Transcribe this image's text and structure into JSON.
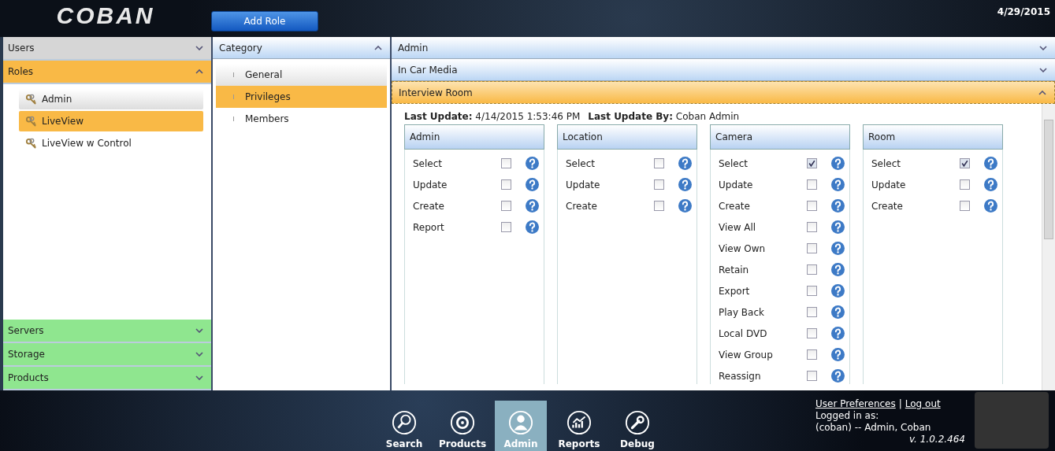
{
  "header": {
    "logo": "COBAN",
    "add_button": "Add Role",
    "date": "4/29/2015"
  },
  "sidebar": {
    "sections": [
      {
        "label": "Users",
        "expanded": false,
        "color": "#d6d6d6"
      },
      {
        "label": "Roles",
        "expanded": true,
        "color": "#f9b946",
        "items": [
          {
            "label": "Admin",
            "selected": false
          },
          {
            "label": "LiveView",
            "selected": true
          },
          {
            "label": "LiveView w Control",
            "selected": false
          }
        ]
      },
      {
        "label": "Servers",
        "expanded": false,
        "color": "#8fe68f"
      },
      {
        "label": "Storage",
        "expanded": false,
        "color": "#8fe68f"
      },
      {
        "label": "Products",
        "expanded": false,
        "color": "#8fe68f"
      }
    ]
  },
  "category": {
    "title": "Category",
    "expanded": true,
    "items": [
      {
        "label": "General",
        "selected": false
      },
      {
        "label": "Privileges",
        "selected": true
      },
      {
        "label": "Members",
        "selected": false
      }
    ]
  },
  "panels": [
    {
      "title": "Admin",
      "expanded": false
    },
    {
      "title": "In Car Media",
      "expanded": false
    },
    {
      "title": "Interview Room",
      "expanded": true
    }
  ],
  "details": {
    "last_update": "**Last Update:** 4/14/2015 1:53:46 PM",
    "last_update_by": "**Last Update By:** Coban Admin",
    "groups": [
      {
        "title": "Admin",
        "privileges": [
          {
            "label": "Select",
            "checked": false
          },
          {
            "label": "Update",
            "checked": false
          },
          {
            "label": "Create",
            "checked": false
          },
          {
            "label": "Report",
            "checked": false
          }
        ]
      },
      {
        "title": "Location",
        "privileges": [
          {
            "label": "Select",
            "checked": false
          },
          {
            "label": "Update",
            "checked": false
          },
          {
            "label": "Create",
            "checked": false
          }
        ]
      },
      {
        "title": "Camera",
        "privileges": [
          {
            "label": "Select",
            "checked": true
          },
          {
            "label": "Update",
            "checked": false
          },
          {
            "label": "Create",
            "checked": false
          },
          {
            "label": "View All",
            "checked": false
          },
          {
            "label": "View Own",
            "checked": false
          },
          {
            "label": "Retain",
            "checked": false
          },
          {
            "label": "Export",
            "checked": false
          },
          {
            "label": "Play Back",
            "checked": false
          },
          {
            "label": "Local DVD",
            "checked": false
          },
          {
            "label": "View Group",
            "checked": false
          },
          {
            "label": "Reassign",
            "checked": false
          }
        ]
      },
      {
        "title": "Room",
        "privileges": [
          {
            "label": "Select",
            "checked": true
          },
          {
            "label": "Update",
            "checked": false
          },
          {
            "label": "Create",
            "checked": false
          }
        ]
      }
    ]
  },
  "footer": {
    "nav": [
      {
        "label": "Search",
        "kind": "search",
        "selected": false
      },
      {
        "label": "Products",
        "kind": "target",
        "selected": false
      },
      {
        "label": "Admin",
        "kind": "person",
        "selected": true
      },
      {
        "label": "Reports",
        "kind": "chart",
        "selected": false
      },
      {
        "label": "Debug",
        "kind": "wrench",
        "selected": false
      }
    ],
    "links": [
      "User Preferences",
      "Log out"
    ],
    "separator": "|",
    "logged_in": "Logged in as:",
    "user": "(coban) -- Admin, Coban",
    "version": "v. 1.0.2.464"
  }
}
